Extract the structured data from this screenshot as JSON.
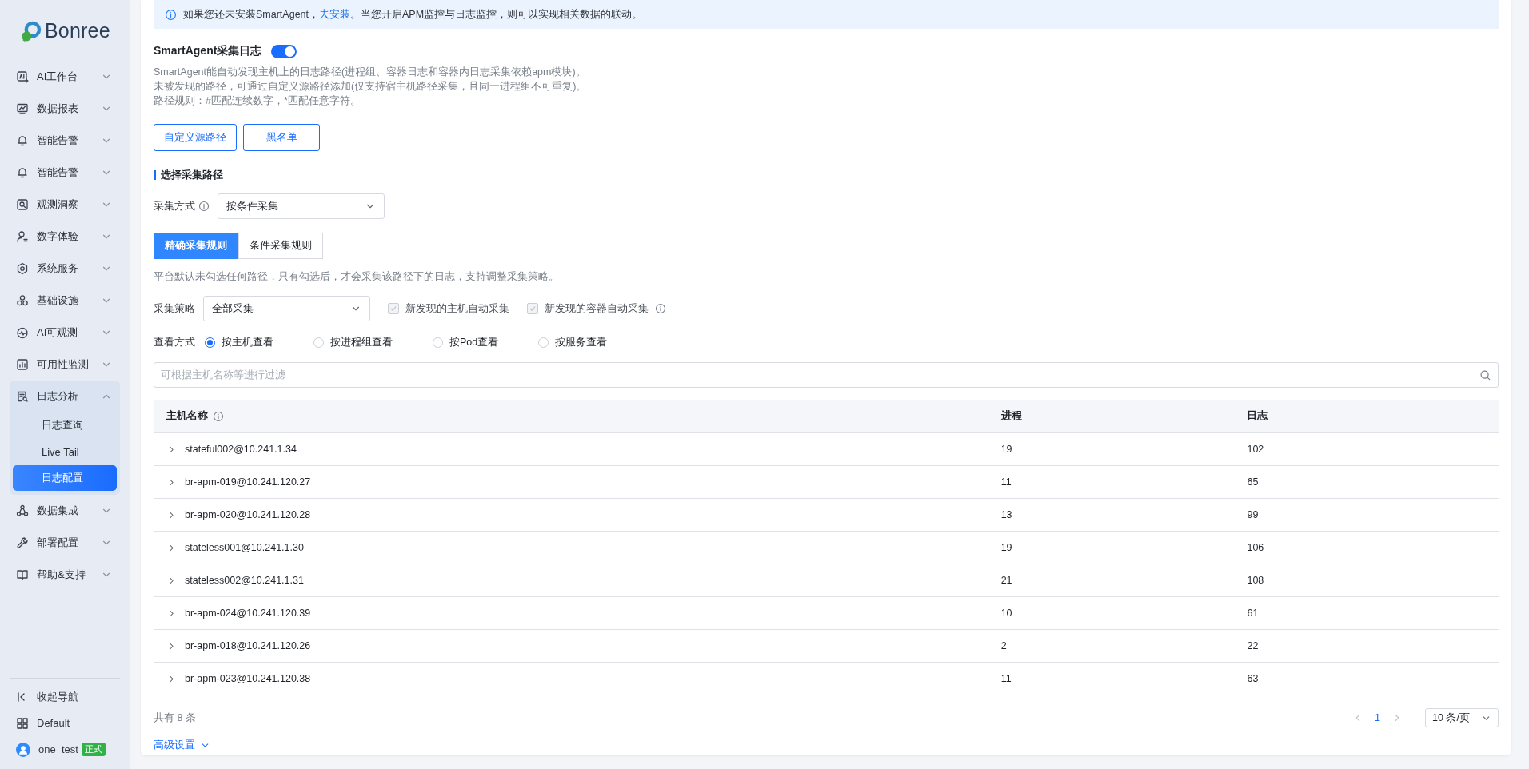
{
  "sidebar": {
    "logo": "Bonree",
    "items": [
      {
        "label": "AI工作台",
        "expanded": false
      },
      {
        "label": "数据报表",
        "expanded": false
      },
      {
        "label": "智能告警",
        "expanded": false
      },
      {
        "label": "智能告警",
        "expanded": false
      },
      {
        "label": "观测洞察",
        "expanded": false
      },
      {
        "label": "数字体验",
        "expanded": false
      },
      {
        "label": "系统服务",
        "expanded": false
      },
      {
        "label": "基础设施",
        "expanded": false
      },
      {
        "label": "AI可观测",
        "expanded": false
      },
      {
        "label": "可用性监测",
        "expanded": false
      },
      {
        "label": "日志分析",
        "expanded": true,
        "children": [
          {
            "label": "日志查询",
            "selected": false
          },
          {
            "label": "Live Tail",
            "selected": false
          },
          {
            "label": "日志配置",
            "selected": true
          }
        ]
      },
      {
        "label": "数据集成",
        "expanded": false
      },
      {
        "label": "部署配置",
        "expanded": false
      },
      {
        "label": "帮助&支持",
        "expanded": false
      }
    ],
    "collapse": "收起导航",
    "workspace": "Default",
    "user": "one_test",
    "user_badge": "正式"
  },
  "banner": {
    "text": "如果您还未安装SmartAgent，",
    "link": "去安装",
    "text_after": "。当您开启APM监控与日志监控，则可以实现相关数据的联动。"
  },
  "agent": {
    "title": "SmartAgent采集日志",
    "on": true,
    "description": [
      "SmartAgent能自动发现主机上的日志路径(进程组、容器日志和容器内日志采集依赖apm模块)。",
      "未被发现的路径，可通过自定义源路径添加(仅支持宿主机路径采集，且同一进程组不可重复)。",
      "路径规则：#匹配连续数字，*匹配任意字符。"
    ],
    "buttons": [
      "自定义源路径",
      "黑名单"
    ]
  },
  "section_title": "选择采集路径",
  "method": {
    "label": "采集方式",
    "info_icon": true,
    "value": "按条件采集"
  },
  "rule_tabs": [
    {
      "label": "精确采集规则",
      "selected": true
    },
    {
      "label": "条件采集规则",
      "selected": false
    }
  ],
  "hint": "平台默认未勾选任何路径，只有勾选后，才会采集该路径下的日志，支持调整采集策略。",
  "strategy": {
    "label": "采集策略",
    "value": "全部采集",
    "checkboxes": [
      {
        "label": "新发现的主机自动采集",
        "checked": true,
        "disabled": true,
        "info_icon": false
      },
      {
        "label": "新发现的容器自动采集",
        "checked": true,
        "disabled": true,
        "info_icon": true
      }
    ]
  },
  "view": {
    "label": "查看方式",
    "options": [
      {
        "label": "按主机查看",
        "selected": true
      },
      {
        "label": "按进程组查看",
        "selected": false
      },
      {
        "label": "按Pod查看",
        "selected": false
      },
      {
        "label": "按服务查看",
        "selected": false
      }
    ]
  },
  "filter": {
    "placeholder": "可根据主机名称等进行过滤"
  },
  "table": {
    "columns": [
      {
        "label": "主机名称",
        "info_icon": true
      },
      {
        "label": "进程",
        "info_icon": false
      },
      {
        "label": "日志",
        "info_icon": false
      }
    ],
    "rows": [
      {
        "host": "stateful002@10.241.1.34",
        "processes": "19",
        "logs": "102",
        "expanded": false
      },
      {
        "host": "br-apm-019@10.241.120.27",
        "processes": "11",
        "logs": "65",
        "expanded": false
      },
      {
        "host": "br-apm-020@10.241.120.28",
        "processes": "13",
        "logs": "99",
        "expanded": false
      },
      {
        "host": "stateless001@10.241.1.30",
        "processes": "19",
        "logs": "106",
        "expanded": false
      },
      {
        "host": "stateless002@10.241.1.31",
        "processes": "21",
        "logs": "108",
        "expanded": false
      },
      {
        "host": "br-apm-024@10.241.120.39",
        "processes": "10",
        "logs": "61",
        "expanded": false
      },
      {
        "host": "br-apm-018@10.241.120.26",
        "processes": "2",
        "logs": "22",
        "expanded": false
      },
      {
        "host": "br-apm-023@10.241.120.38",
        "processes": "11",
        "logs": "63",
        "expanded": false
      }
    ]
  },
  "pagination": {
    "total": "共有 8 条",
    "pages": [
      {
        "label": "1",
        "selected": true
      }
    ],
    "page_size": "10 条/页"
  },
  "advanced": "高级设置"
}
